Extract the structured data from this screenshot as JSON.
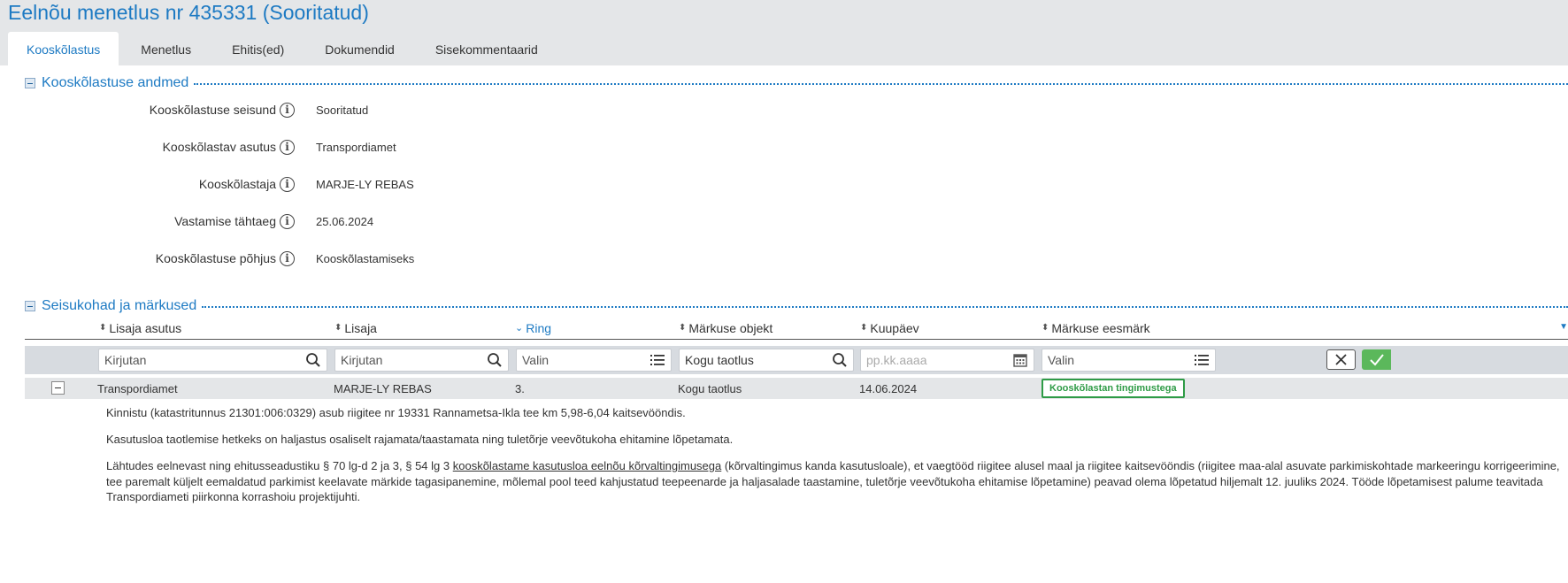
{
  "page": {
    "title": "Eelnõu menetlus nr 435331 (Sooritatud)"
  },
  "tabs": [
    {
      "label": "Kooskõlastus",
      "active": true
    },
    {
      "label": "Menetlus",
      "active": false
    },
    {
      "label": "Ehitis(ed)",
      "active": false
    },
    {
      "label": "Dokumendid",
      "active": false
    },
    {
      "label": "Sisekommentaarid",
      "active": false
    }
  ],
  "approval_section": {
    "title": "Kooskõlastuse andmed",
    "fields": [
      {
        "label": "Kooskõlastuse seisund",
        "value": "Sooritatud"
      },
      {
        "label": "Kooskõlastav asutus",
        "value": "Transpordiamet"
      },
      {
        "label": "Kooskõlastaja",
        "value": "MARJE-LY REBAS"
      },
      {
        "label": "Vastamise tähtaeg",
        "value": "25.06.2024"
      },
      {
        "label": "Kooskõlastuse põhjus",
        "value": "Kooskõlastamiseks"
      }
    ]
  },
  "positions_section": {
    "title": "Seisukohad ja märkused",
    "columns": [
      {
        "label": "Lisaja asutus",
        "sorted": false
      },
      {
        "label": "Lisaja",
        "sorted": false
      },
      {
        "label": "Ring",
        "sorted": true
      },
      {
        "label": "Märkuse objekt",
        "sorted": false
      },
      {
        "label": "Kuupäev",
        "sorted": false
      },
      {
        "label": "Märkuse eesmärk",
        "sorted": false
      }
    ],
    "filters": {
      "institution": {
        "placeholder": "Kirjutan"
      },
      "author": {
        "placeholder": "Kirjutan"
      },
      "round": {
        "placeholder": "Valin"
      },
      "object": {
        "value": "Kogu taotlus"
      },
      "date": {
        "placeholder": "pp.kk.aaaa"
      },
      "purpose": {
        "placeholder": "Valin"
      }
    },
    "row": {
      "institution": "Transpordiamet",
      "author": "MARJE-LY REBAS",
      "round": "3.",
      "object": "Kogu taotlus",
      "date": "14.06.2024",
      "purpose": "Kooskõlastan tingimustega"
    },
    "detail": {
      "p1": "Kinnistu (katastritunnus 21301:006:0329) asub riigitee nr 19331 Rannametsa-Ikla tee km 5,98-6,04 kaitsevööndis.",
      "p2": "Kasutusloa taotlemise hetkeks on haljastus osaliselt rajamata/taastamata ning tuletõrje veevõtukoha ehitamine lõpetamata.",
      "p3_before": "Lähtudes eelnevast ning ehitusseadustiku § 70 lg-d 2 ja 3, § 54 lg 3 ",
      "p3_underlined": "kooskõlastame kasutusloa eelnõu kõrvaltingimusega",
      "p3_after": " (kõrvaltingimus kanda kasutusloale), et vaegtööd riigitee alusel maal ja riigitee kaitsevööndis (riigitee maa-alal asuvate parkimiskohtade markeeringu korrigeerimine, tee paremalt küljelt eemaldatud parkimist keelavate märkide tagasipanemine, mõlemal pool teed kahjustatud teepeenarde ja haljasalade taastamine, tuletõrje veevõtukoha ehitamise lõpetamine) peavad olema lõpetatud hiljemalt 12. juuliks 2024. Tööde lõpetamisest palume teavitada Transpordiameti piirkonna korrashoiu projektijuhti."
    }
  },
  "colors": {
    "accent": "#1d7ac3",
    "header_bg": "#e4e6e8",
    "badge_green": "#2e9b46",
    "apply_green": "#5bb85b"
  },
  "icons": {
    "info": "info-icon",
    "search": "search-icon",
    "list": "list-icon",
    "calendar": "calendar-icon",
    "clear": "close-icon",
    "apply": "check-icon"
  }
}
